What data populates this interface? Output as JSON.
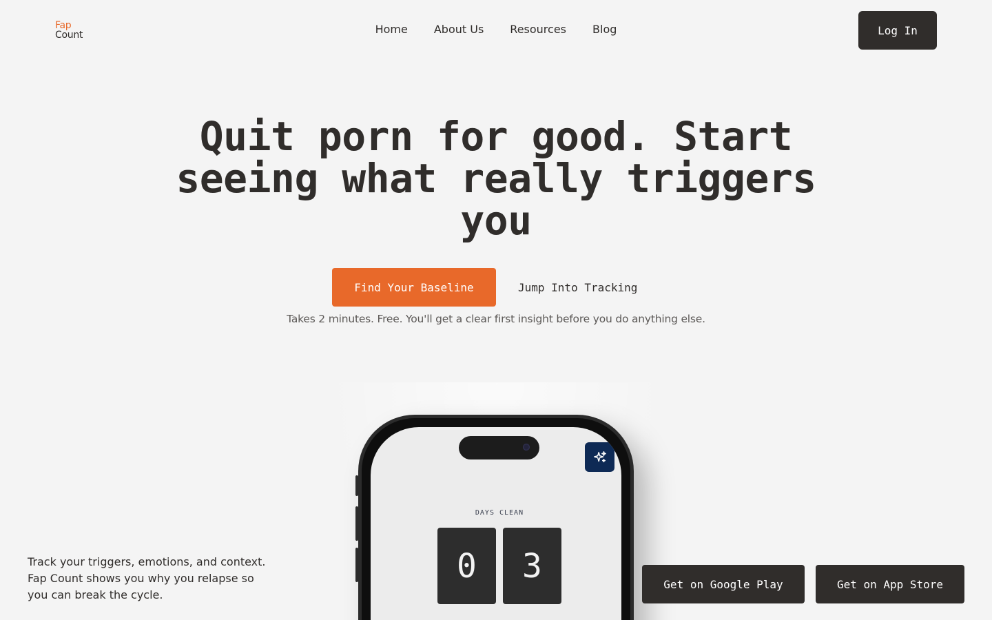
{
  "header": {
    "logo_line1": "Fap",
    "logo_line2": "Count",
    "nav": [
      "Home",
      "About Us",
      "Resources",
      "Blog"
    ],
    "login_label": "Log In"
  },
  "hero": {
    "headline": "Quit porn for good. Start seeing what really triggers you",
    "primary_cta": "Find Your Baseline",
    "secondary_cta": "Jump Into Tracking",
    "subnote": "Takes 2 minutes. Free. You'll get a clear first insight before you do anything else."
  },
  "bottom": {
    "description": "Track your triggers, emotions, and context. Fap Count shows you why you relapse so you can break the cycle.",
    "google_play": "Get on Google Play",
    "app_store": "Get on App Store"
  },
  "phone": {
    "days_label": "DAYS CLEAN",
    "digits": [
      "0",
      "3"
    ],
    "insights_icon": "sparkles-icon"
  },
  "colors": {
    "accent": "#e8692a",
    "dark": "#302d2b",
    "background": "#f4f4f4",
    "navy": "#0e2a55"
  }
}
